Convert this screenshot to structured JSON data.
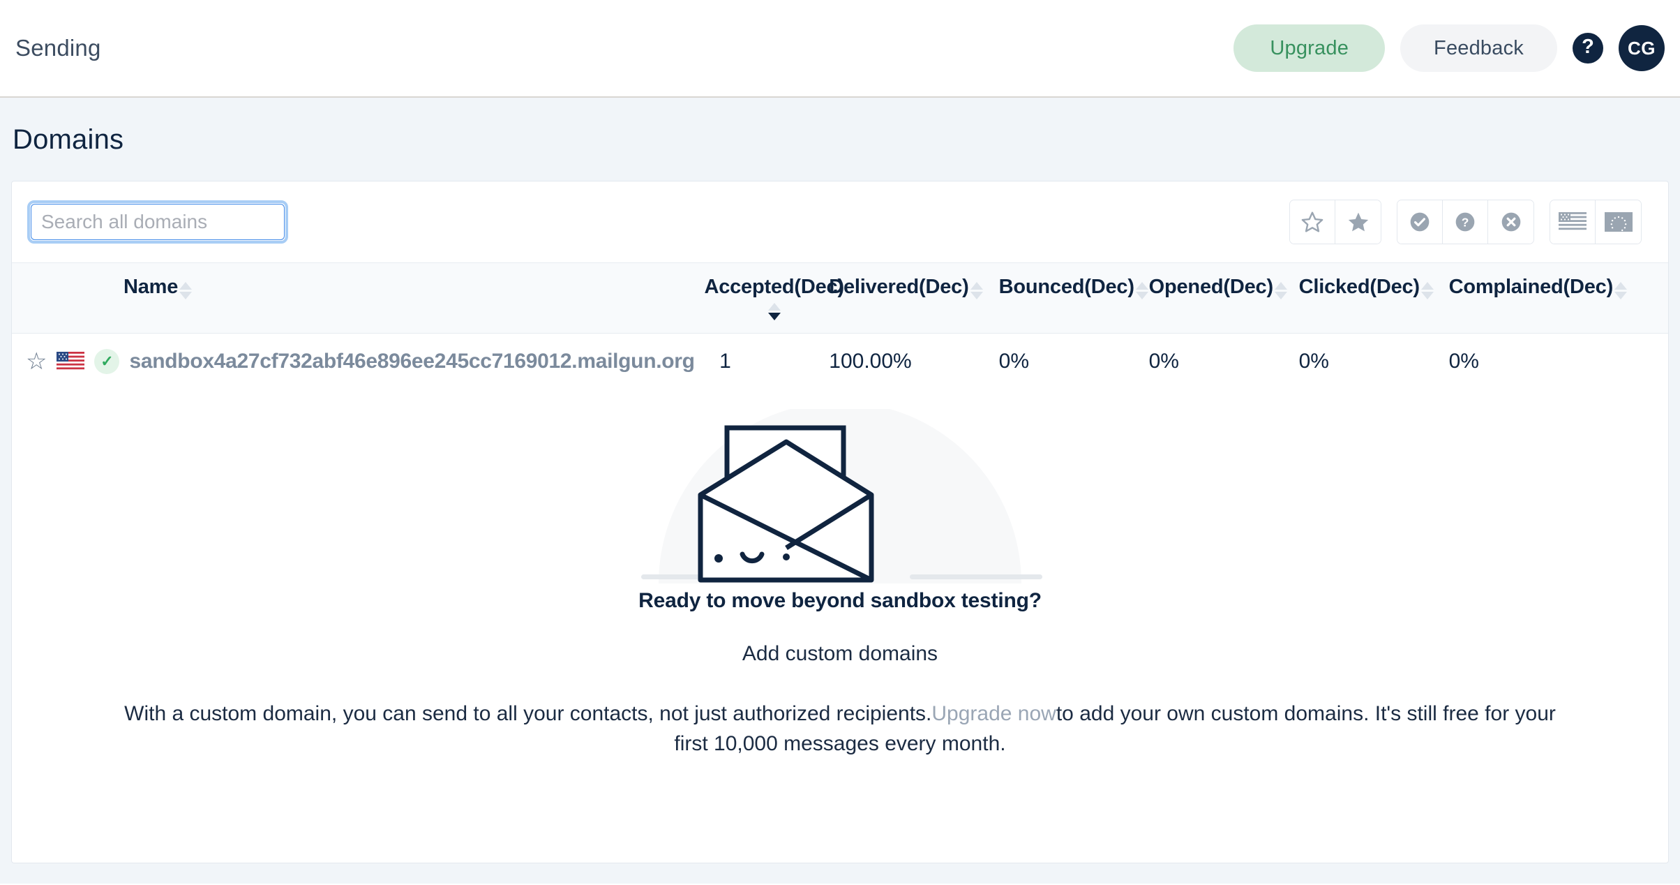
{
  "topbar": {
    "title": "Sending",
    "upgrade_label": "Upgrade",
    "feedback_label": "Feedback",
    "help_glyph": "?",
    "avatar_initials": "CG"
  },
  "page": {
    "title": "Domains"
  },
  "search": {
    "value": "",
    "placeholder": "Search all domains"
  },
  "toolbar": {
    "groups": [
      {
        "buttons": [
          {
            "icon": "star-outline-icon"
          },
          {
            "icon": "star-filled-icon"
          }
        ]
      },
      {
        "buttons": [
          {
            "icon": "check-circle-icon"
          },
          {
            "icon": "question-circle-icon"
          },
          {
            "icon": "x-circle-icon"
          }
        ]
      },
      {
        "buttons": [
          {
            "icon": "flag-us-icon"
          },
          {
            "icon": "flag-eu-icon"
          }
        ]
      }
    ]
  },
  "table": {
    "columns": [
      {
        "label": "Name",
        "sort": "none",
        "align": "left",
        "stack": false
      },
      {
        "label": "Accepted(Dec)",
        "sort": "descending",
        "align": "center",
        "stack": true
      },
      {
        "label": "Delivered(Dec)",
        "sort": "none",
        "align": "left",
        "stack": false
      },
      {
        "label": "Bounced(Dec)",
        "sort": "none",
        "align": "left",
        "stack": false
      },
      {
        "label": "Opened(Dec)",
        "sort": "none",
        "align": "left",
        "stack": false
      },
      {
        "label": "Clicked(Dec)",
        "sort": "none",
        "align": "left",
        "stack": false
      },
      {
        "label": "Complained(Dec)",
        "sort": "none",
        "align": "left",
        "stack": false
      }
    ],
    "rows": [
      {
        "starred": false,
        "region_icon": "flag-us-icon",
        "status_icon": "verified-check-icon",
        "name": "sandbox4a27cf732abf46e896ee245cc7169012.mailgun.org",
        "accepted": "1",
        "delivered": "100.00%",
        "bounced": "0%",
        "opened": "0%",
        "clicked": "0%",
        "complained": "0%"
      }
    ]
  },
  "promo": {
    "heading": "Ready to move beyond sandbox testing?",
    "subheading": "Add custom domains",
    "body_before_link": "With a custom domain, you can send to all your contacts, not just authorized recipients.",
    "link_label": "Upgrade now",
    "body_after_link": "to add your own custom domains. It's still free for your first 10,000 messages every month."
  },
  "colors": {
    "brand_dark": "#0f2440",
    "upgrade_green": "#37915e",
    "upgrade_bg": "#d3e9da",
    "focus_blue": "#3b86e8",
    "page_bg": "#f1f5f9",
    "muted": "#7b8a9c"
  }
}
